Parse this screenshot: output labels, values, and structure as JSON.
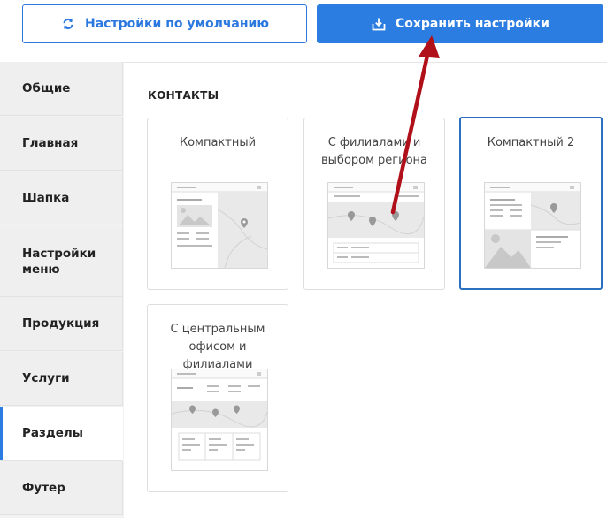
{
  "toolbar": {
    "default_label": "Настройки по умолчанию",
    "save_label": "Сохранить настройки",
    "accent": "#2b7de1"
  },
  "sidebar": {
    "items": [
      {
        "label": "Общие"
      },
      {
        "label": "Главная"
      },
      {
        "label": "Шапка"
      },
      {
        "label": "Настройки меню"
      },
      {
        "label": "Продукция"
      },
      {
        "label": "Услуги"
      },
      {
        "label": "Разделы",
        "active": true
      },
      {
        "label": "Футер"
      }
    ]
  },
  "main": {
    "section_title": "КОНТАКТЫ",
    "cards": [
      {
        "title": "Компактный",
        "selected": false
      },
      {
        "title": "С филиалами и выбором региона",
        "selected": false
      },
      {
        "title": "Компактный 2",
        "selected": true
      },
      {
        "title": "С центральным офисом и филиалами",
        "selected": false
      }
    ]
  },
  "annotation": {
    "color": "#b0101a"
  }
}
